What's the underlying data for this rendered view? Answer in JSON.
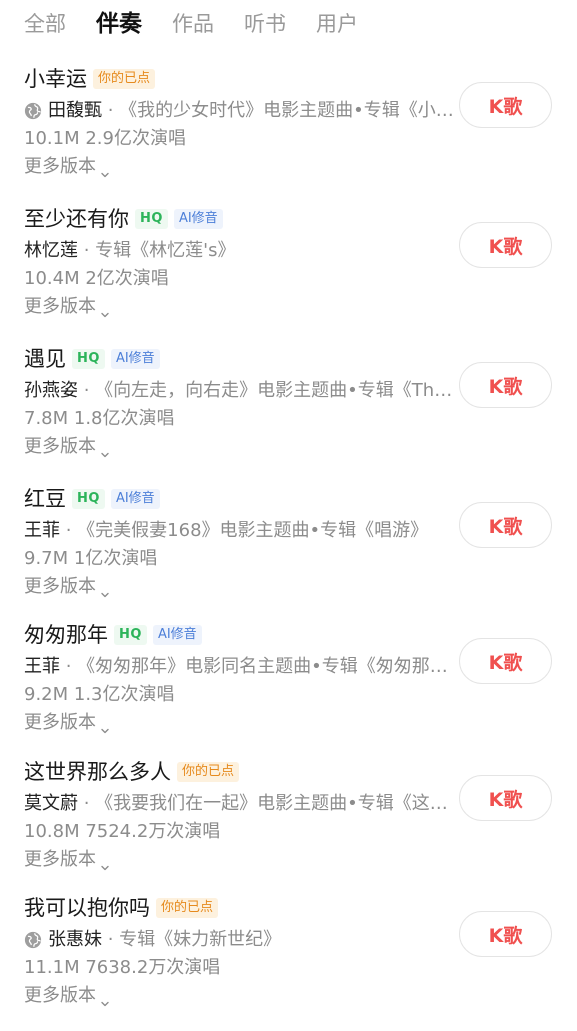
{
  "tabs": [
    {
      "label": "全部",
      "active": false
    },
    {
      "label": "伴奏",
      "active": true
    },
    {
      "label": "作品",
      "active": false
    },
    {
      "label": "听书",
      "active": false
    },
    {
      "label": "用户",
      "active": false
    }
  ],
  "songs": [
    {
      "title": "小幸运",
      "badges": [
        {
          "type": "played",
          "text": "你的已点"
        }
      ],
      "globe_icon": true,
      "artist": "田馥甄",
      "separator": " · ",
      "album": "《我的少女时代》电影主题曲•专辑《小幸运》",
      "stats": "10.1M 2.9亿次演唱",
      "more": "更多版本",
      "k_label": "K歌"
    },
    {
      "title": "至少还有你",
      "badges": [
        {
          "type": "hq",
          "text": "HQ"
        },
        {
          "type": "ai",
          "text": "AI修音"
        }
      ],
      "globe_icon": false,
      "artist": "林忆莲",
      "separator": " · ",
      "album": "专辑《林忆莲's》",
      "stats": "10.4M 2亿次演唱",
      "more": "更多版本",
      "k_label": "K歌"
    },
    {
      "title": "遇见",
      "badges": [
        {
          "type": "hq",
          "text": "HQ"
        },
        {
          "type": "ai",
          "text": "AI修音"
        }
      ],
      "globe_icon": false,
      "artist": "孙燕姿",
      "separator": " · ",
      "album": "《向左走，向右走》电影主题曲•专辑《The Moment》",
      "stats": "7.8M 1.8亿次演唱",
      "more": "更多版本",
      "k_label": "K歌"
    },
    {
      "title": "红豆",
      "badges": [
        {
          "type": "hq",
          "text": "HQ"
        },
        {
          "type": "ai",
          "text": "AI修音"
        }
      ],
      "globe_icon": false,
      "artist": "王菲",
      "separator": " · ",
      "album": "《完美假妻168》电影主题曲•专辑《唱游》",
      "stats": "9.7M 1亿次演唱",
      "more": "更多版本",
      "k_label": "K歌"
    },
    {
      "title": "匆匆那年",
      "badges": [
        {
          "type": "hq",
          "text": "HQ"
        },
        {
          "type": "ai",
          "text": "AI修音"
        }
      ],
      "globe_icon": false,
      "artist": "王菲",
      "separator": " · ",
      "album": "《匆匆那年》电影同名主题曲•专辑《匆匆那年》",
      "stats": "9.2M 1.3亿次演唱",
      "more": "更多版本",
      "k_label": "K歌"
    },
    {
      "title": "这世界那么多人",
      "badges": [
        {
          "type": "played",
          "text": "你的已点"
        }
      ],
      "globe_icon": false,
      "artist": "莫文蔚",
      "separator": " · ",
      "album": "《我要我们在一起》电影主题曲•专辑《这世界那么多人》",
      "stats": "10.8M 7524.2万次演唱",
      "more": "更多版本",
      "k_label": "K歌"
    },
    {
      "title": "我可以抱你吗",
      "badges": [
        {
          "type": "played",
          "text": "你的已点"
        }
      ],
      "globe_icon": true,
      "artist": "张惠妹",
      "separator": " · ",
      "album": "专辑《妹力新世纪》",
      "stats": "11.1M 7638.2万次演唱",
      "more": "更多版本",
      "k_label": "K歌"
    }
  ],
  "colors": {
    "accent": "#f0504f",
    "muted": "#8c8c8c",
    "played_badge_bg": "#fdf1de",
    "played_badge_fg": "#e68a1d",
    "hq_fg": "#2cb45a",
    "ai_fg": "#4c7fd8"
  },
  "icons": {
    "globe": "globe-icon",
    "chevron": "chevron-down-icon"
  }
}
